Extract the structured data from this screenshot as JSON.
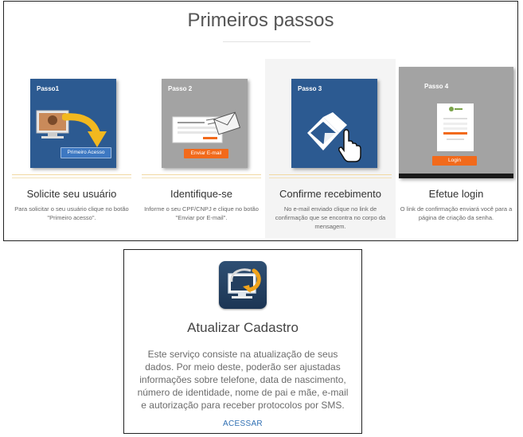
{
  "header": {
    "title": "Primeiros passos"
  },
  "steps": [
    {
      "card_label": "Passo1",
      "button": "Primeiro Acesso",
      "title": "Solicite seu usuário",
      "description": "Para solicitar o seu usuário clique no botão \"Primeiro acesso\"."
    },
    {
      "card_label": "Passo 2",
      "button": "Enviar E-mail",
      "title": "Identifique-se",
      "description": "Informe o seu CPF/CNPJ e clique no botão \"Enviar por E-mail\"."
    },
    {
      "card_label": "Passo 3",
      "button": "",
      "title": "Confirme recebimento",
      "description": "No e-mail enviado clique no link de confirmação que se encontra no corpo da mensagem."
    },
    {
      "card_label": "Passo 4",
      "button": "Login",
      "title": "Efetue login",
      "description": "O link de confirmação enviará você para a página de criação da senha."
    }
  ],
  "service": {
    "icon": "monitor-refresh-icon",
    "title": "Atualizar Cadastro",
    "description": "Este serviço consiste na atualização de seus dados. Por meio deste, poderão ser ajustadas informações sobre telefone, data de nascimento, número de identidade, nome de pai e mãe, e-mail e autorização para receber protocolos por SMS.",
    "link": "ACESSAR"
  },
  "colors": {
    "card_blue": "#2c5a91",
    "card_gray": "#a3a3a3",
    "accent_orange": "#f26a1b",
    "link_blue": "#2f6fb3"
  }
}
